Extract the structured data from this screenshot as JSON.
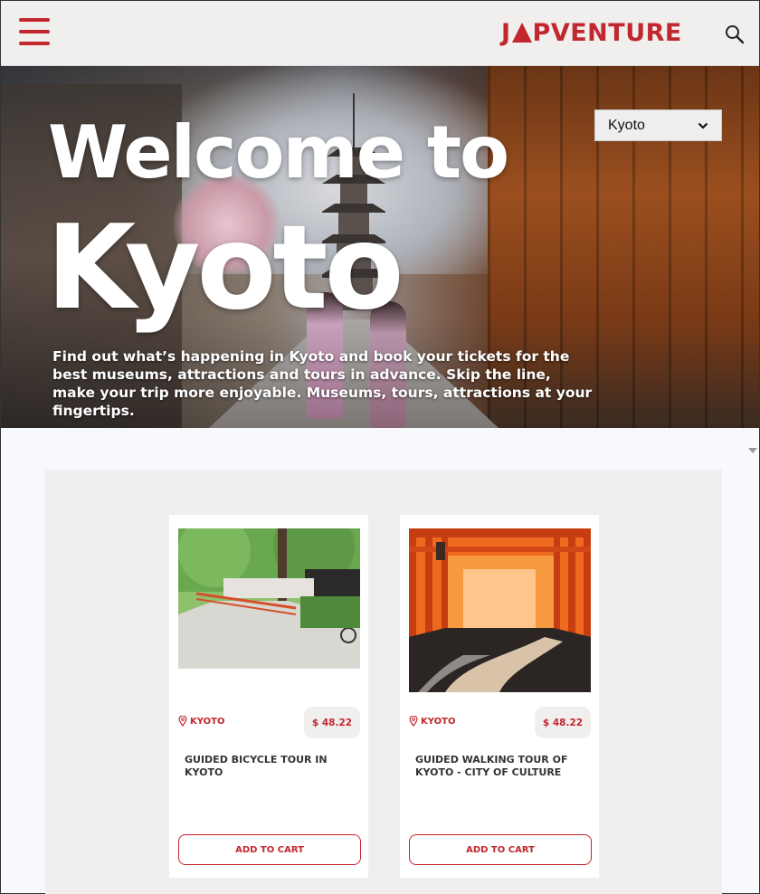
{
  "header": {
    "logo_left": "J",
    "logo_right": "PVENTURE",
    "brand_color": "#c1272d"
  },
  "hero": {
    "title_line1": "Welcome to",
    "title_line2": "Kyoto",
    "description": "Find out what’s happening in Kyoto and book your tickets for the best museums, attractions and tours in advance. Skip the line, make your trip more enjoyable. Museums, tours, attractions at your fingertips.",
    "city_select": {
      "value": "Kyoto"
    }
  },
  "products": [
    {
      "location": "KYOTO",
      "price": "$ 48.22",
      "title": "GUIDED BICYCLE TOUR IN KYOTO",
      "button": "ADD TO CART"
    },
    {
      "location": "KYOTO",
      "price": "$ 48.22",
      "title": "GUIDED WALKING TOUR OF KYOTO - CITY OF CULTURE",
      "button": "ADD TO CART"
    }
  ]
}
